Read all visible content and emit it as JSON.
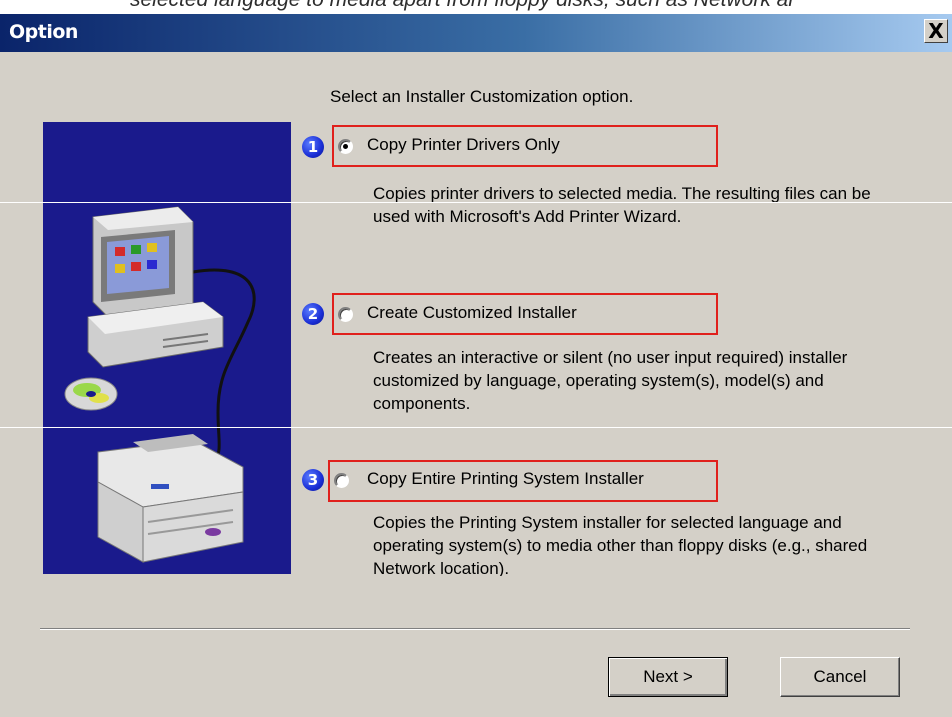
{
  "background_text": "selected language to media apart from floppy disks, such as Network ar",
  "dialog": {
    "title": "Option",
    "close_label": "X",
    "prompt": "Select an Installer Customization option.",
    "options": [
      {
        "number": "1",
        "label": "Copy Printer Drivers Only",
        "selected": true,
        "description": "Copies printer drivers to selected media.  The resulting files can be used with Microsoft's Add Printer Wizard."
      },
      {
        "number": "2",
        "label": "Create Customized Installer",
        "selected": false,
        "description": "Creates an interactive or silent (no user input required) installer customized by language, operating system(s), model(s) and components."
      },
      {
        "number": "3",
        "label": "Copy Entire Printing System Installer",
        "selected": false,
        "description": "Copies the Printing System installer for selected language and operating system(s) to media other than floppy disks (e.g., shared Network location)."
      }
    ],
    "buttons": {
      "next": "Next >",
      "cancel": "Cancel"
    }
  },
  "colors": {
    "title_bar_start": "#0a246a",
    "title_bar_end": "#a6caf0",
    "panel_background": "#1a1a8c",
    "highlight_box": "#e0201c",
    "dialog_face": "#d4d0c8"
  }
}
